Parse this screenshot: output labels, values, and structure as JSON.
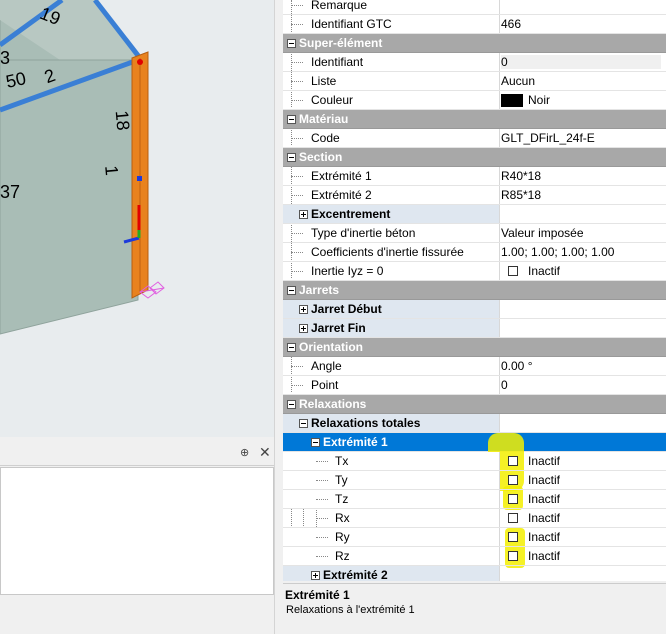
{
  "viewport": {
    "labels": [
      "19",
      "3",
      "50",
      "2",
      "18",
      "1",
      "37"
    ]
  },
  "lower_panel": {
    "pin": "⊕",
    "close": "✕"
  },
  "properties": {
    "rows": [
      {
        "type": "prop",
        "name": "Remarque",
        "value": ""
      },
      {
        "type": "prop",
        "name": "Identifiant GTC",
        "value": "466"
      },
      {
        "type": "cat",
        "name": "Super-élément"
      },
      {
        "type": "prop",
        "name": "Identifiant",
        "value": "0"
      },
      {
        "type": "prop",
        "name": "Liste",
        "value": "Aucun"
      },
      {
        "type": "prop",
        "name": "Couleur",
        "value": "Noir"
      },
      {
        "type": "cat",
        "name": "Matériau"
      },
      {
        "type": "prop",
        "name": "Code",
        "value": "GLT_DFirL_24f-E"
      },
      {
        "type": "cat",
        "name": "Section"
      },
      {
        "type": "prop",
        "name": "Extrémité 1",
        "value": "R40*18"
      },
      {
        "type": "prop",
        "name": "Extrémité 2",
        "value": "R85*18"
      },
      {
        "type": "group",
        "name": "Excentrement",
        "value": ""
      },
      {
        "type": "prop",
        "name": "Type d'inertie béton",
        "value": "Valeur imposée"
      },
      {
        "type": "prop",
        "name": "Coefficients d'inertie fissurée",
        "value": "1.00; 1.00; 1.00; 1.00"
      },
      {
        "type": "prop",
        "name": "Inertie Iyz = 0",
        "value": "Inactif"
      },
      {
        "type": "cat",
        "name": "Jarrets"
      },
      {
        "type": "group",
        "name": "Jarret Début",
        "value": ""
      },
      {
        "type": "group",
        "name": "Jarret Fin",
        "value": ""
      },
      {
        "type": "cat",
        "name": "Orientation"
      },
      {
        "type": "prop",
        "name": "Angle",
        "value": "0.00 °"
      },
      {
        "type": "prop",
        "name": "Point",
        "value": "0"
      },
      {
        "type": "cat",
        "name": "Relaxations"
      },
      {
        "type": "sub",
        "name": "Relaxations totales",
        "value": ""
      },
      {
        "type": "subsel",
        "name": "Extrémité 1",
        "value": ""
      },
      {
        "type": "prop",
        "name": "Tx",
        "value": "Inactif"
      },
      {
        "type": "prop",
        "name": "Ty",
        "value": "Inactif"
      },
      {
        "type": "prop",
        "name": "Tz",
        "value": "Inactif"
      },
      {
        "type": "prop",
        "name": "Rx",
        "value": "Inactif"
      },
      {
        "type": "prop",
        "name": "Ry",
        "value": "Inactif"
      },
      {
        "type": "prop",
        "name": "Rz",
        "value": "Inactif"
      },
      {
        "type": "subgroup",
        "name": "Extrémité 2",
        "value": ""
      }
    ]
  },
  "description": {
    "title": "Extrémité 1",
    "text": "Relaxations à l'extrémité 1"
  },
  "colors": {
    "category_bg": "#a8a8a8",
    "selection": "#0078d7",
    "highlight": "#f3ee00",
    "beam": "#e8821e",
    "wall": "#a9bdb6"
  }
}
